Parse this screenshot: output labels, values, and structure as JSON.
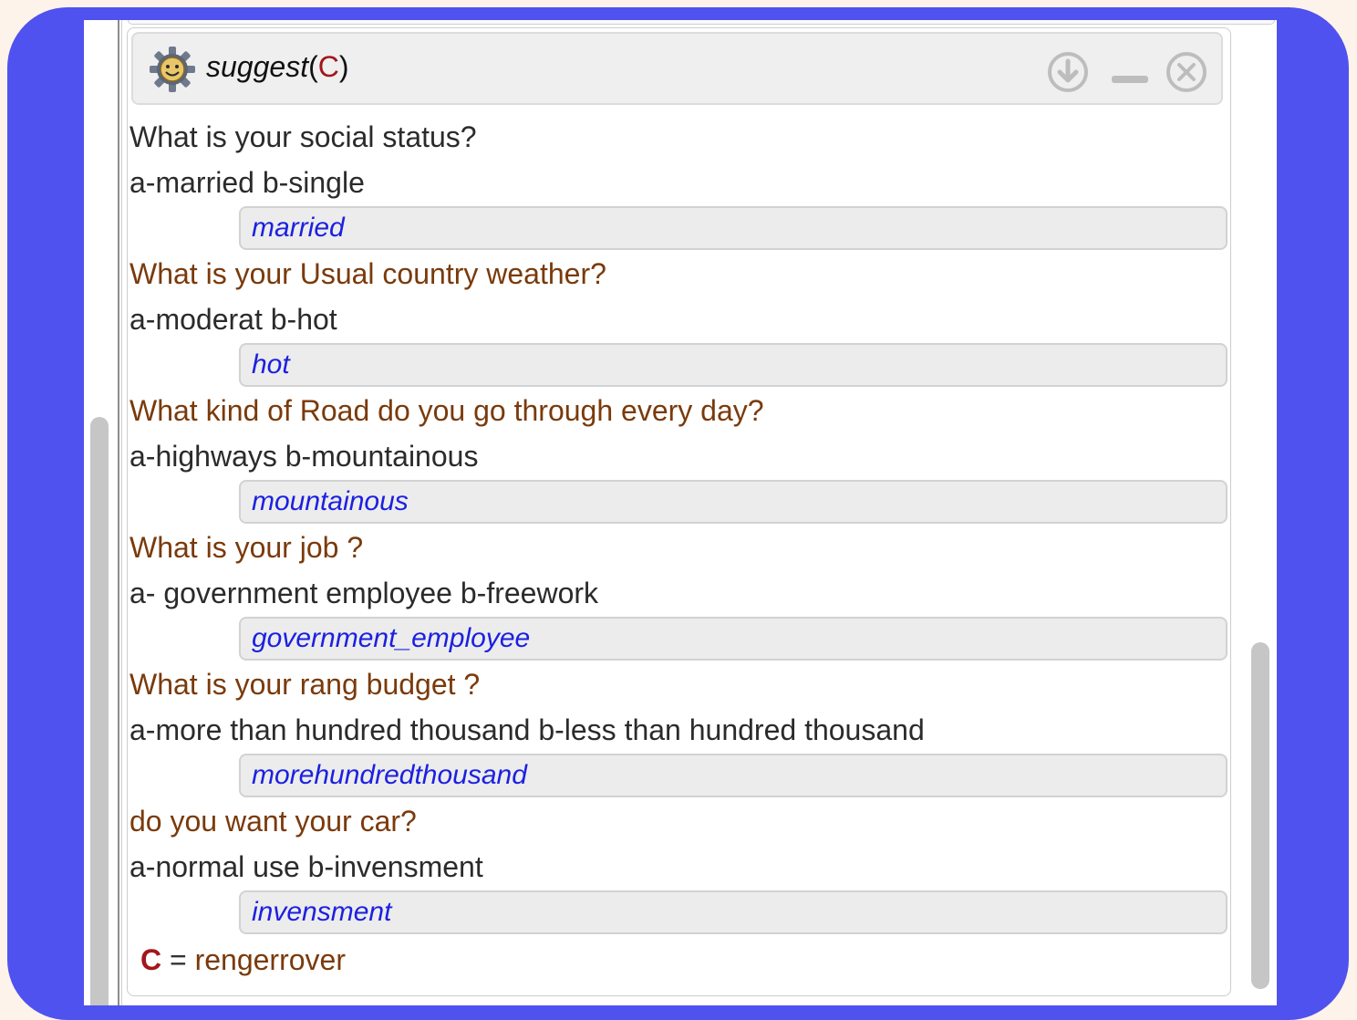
{
  "panel": {
    "title_func": "suggest",
    "title_open": "(",
    "title_var": "C",
    "title_close": ")",
    "icons": {
      "logo": "smiling-gear-icon",
      "download": "download-icon",
      "minimize": "minimize-icon",
      "close": "close-icon"
    }
  },
  "dialog": [
    {
      "question": "What is your social status?",
      "options": "a-married b-single",
      "answer": "married"
    },
    {
      "question": "What is your Usual country weather?",
      "options": "a-moderat b-hot",
      "answer": "hot"
    },
    {
      "question": "What kind of Road do you go through every day?",
      "options": "a-highways b-mountainous",
      "answer": "mountainous"
    },
    {
      "question": "What is your job ?",
      "options": "a- government employee b-freework",
      "answer": "government_employee"
    },
    {
      "question": "What is your rang budget ?",
      "options": "a-more than hundred thousand b-less than hundred thousand",
      "answer": "morehundredthousand"
    },
    {
      "question": "do you want your car?",
      "options": "a-normal use b-invensment",
      "answer": "invensment"
    }
  ],
  "result": {
    "variable": "C",
    "equals": "=",
    "value": "rengerrover"
  },
  "colors": {
    "frame": "#4f52ee",
    "page_background": "#fdf3ea",
    "question_text": "#7a3a0b",
    "answer_text": "#1c20e0",
    "variable": "#a3161c"
  }
}
